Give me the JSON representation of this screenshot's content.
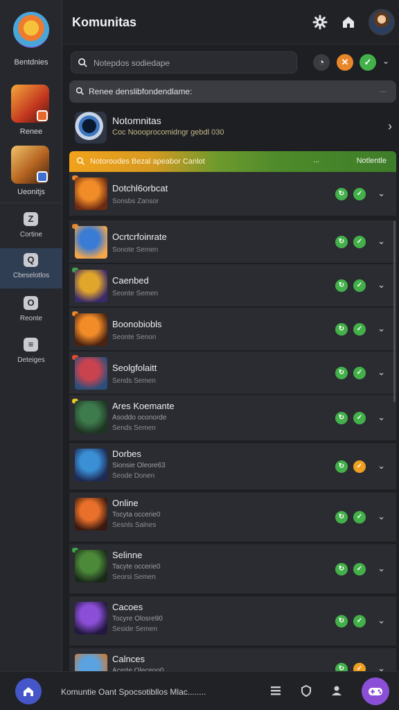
{
  "app": {
    "title": "Komunitas"
  },
  "sidebar": {
    "top_label": "Bentdnies",
    "games": [
      {
        "label": "Renee",
        "badge_color": "#e8682c"
      },
      {
        "label": "Ueonitjs",
        "badge_color": "#3e6fd0"
      }
    ],
    "nav": [
      {
        "label": "Cortine",
        "icon": "z-icon"
      },
      {
        "label": "Cbeselotlos",
        "icon": "search-icon",
        "active": true
      },
      {
        "label": "Reonte",
        "icon": "ring-icon"
      },
      {
        "label": "Deteiges",
        "icon": "list-icon"
      }
    ]
  },
  "header": {
    "icons": [
      "settings-icon",
      "home-icon",
      "user-avatar"
    ]
  },
  "search": {
    "placeholder": "Notepdos sodiedape"
  },
  "quick_buttons": [
    {
      "name": "mic-button",
      "glyph": "◔",
      "color": "#3a3c42"
    },
    {
      "name": "x-button",
      "glyph": "✕",
      "color": "#e8862a"
    },
    {
      "name": "check-button",
      "glyph": "✓",
      "color": "#43b04a"
    }
  ],
  "filter": {
    "text": "Renee denslibfondendlame:",
    "dots": "..."
  },
  "community": {
    "name": "Notomnitas",
    "subtitle": "Coc Noooprocomidngr gebdl 030"
  },
  "strip": {
    "left_text": "Notoroudes Bezal apeabor Canlot",
    "mid_text": "...",
    "right_text": "Notlentle"
  },
  "games": [
    {
      "title": "Dotchl6orbcat",
      "meta1": "",
      "meta2": "Sonsbs Zansor",
      "pip": "#e8862a",
      "colors": [
        "#f28c28",
        "#6b2a12"
      ],
      "actions": [
        "#43b04a",
        "#43b04a"
      ]
    },
    {
      "title": "Ocrtcrfoinrate",
      "meta1": "",
      "meta2": "Sonote Semen",
      "pip": "#e8862a",
      "colors": [
        "#3a7bd5",
        "#f3a64b"
      ],
      "actions": [
        "#43b04a",
        "#43b04a"
      ]
    },
    {
      "title": "Caenbed",
      "meta1": "",
      "meta2": "Seonte Semen",
      "pip": "#3fa34d",
      "colors": [
        "#e0a52b",
        "#3a2a6a"
      ],
      "actions": [
        "#43b04a",
        "#43b04a"
      ]
    },
    {
      "title": "Boonobiobls",
      "meta1": "",
      "meta2": "Seonte Senon",
      "pip": "#e8862a",
      "colors": [
        "#f28c28",
        "#4a2210"
      ],
      "actions": [
        "#43b04a",
        "#43b04a"
      ]
    },
    {
      "title": "Seolgfolaitt",
      "meta1": "",
      "meta2": "Sends Semen",
      "pip": "#e84a2a",
      "colors": [
        "#c9434f",
        "#2a4f7a"
      ],
      "actions": [
        "#43b04a",
        "#43b04a"
      ]
    },
    {
      "title": "Ares Koemante",
      "meta1": "Asoddo oconorde",
      "meta2": "Sends Semen",
      "pip": "#e8c52a",
      "colors": [
        "#3d7a4c",
        "#1e3322"
      ],
      "actions": [
        "#43b04a",
        "#43b04a"
      ]
    },
    {
      "title": "Dorbes",
      "meta1": "Sionsie Oleore63",
      "meta2": "Seode Donen",
      "pip": "",
      "colors": [
        "#3a8fd5",
        "#1d2a55"
      ],
      "actions": [
        "#43b04a",
        "#f0a020"
      ]
    },
    {
      "title": "Online",
      "meta1": "Tocyta occerie0",
      "meta2": "Sesnls Salnes",
      "pip": "",
      "colors": [
        "#e8702a",
        "#3a1a10"
      ],
      "actions": [
        "#43b04a",
        "#43b04a"
      ]
    },
    {
      "title": "Selinne",
      "meta1": "Tacyte occerie0",
      "meta2": "Seorsi Semen",
      "pip": "#3fa34d",
      "colors": [
        "#4c8a3a",
        "#1a2a18"
      ],
      "actions": [
        "#43b04a",
        "#43b04a"
      ]
    },
    {
      "title": "Cacoes",
      "meta1": "Tocyre Olosre90",
      "meta2": "Seside Semen",
      "pip": "",
      "colors": [
        "#8a4fd6",
        "#231840"
      ],
      "actions": [
        "#43b04a",
        "#43b04a"
      ]
    },
    {
      "title": "Calnces",
      "meta1": "Acerte Oleceno0",
      "meta2": "",
      "pip": "",
      "colors": [
        "#5aa3e0",
        "#c97a3a"
      ],
      "actions": [
        "#43b04a",
        "#f0a020"
      ]
    }
  ],
  "bottom": {
    "status_text": "Komuntie Oant Spocsotibllos Mlac........"
  }
}
